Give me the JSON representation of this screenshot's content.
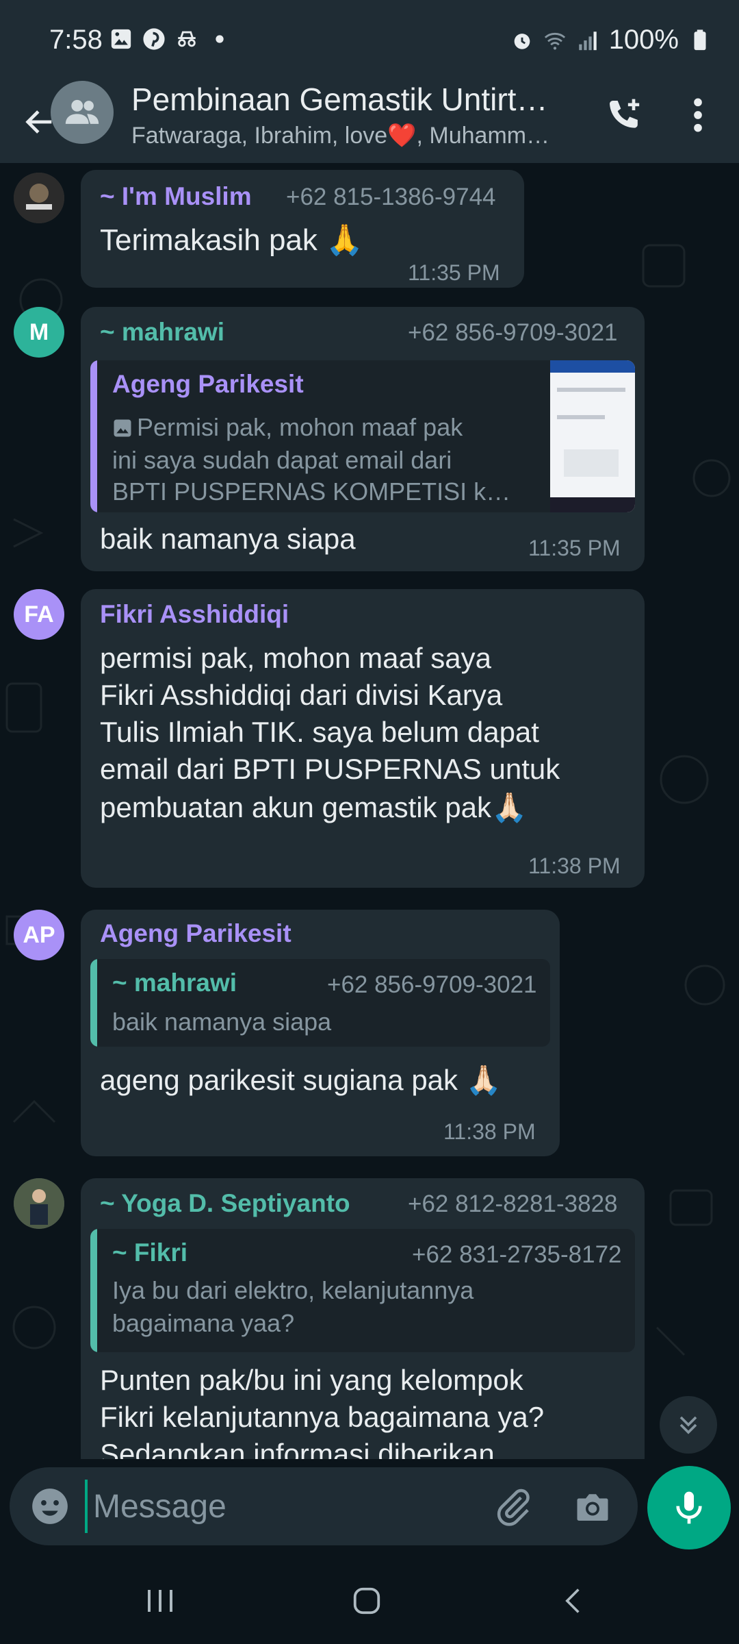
{
  "status_bar": {
    "time": "7:58",
    "battery": "100%",
    "left_icons": [
      "gallery-icon",
      "pinterest-icon",
      "incognito-icon",
      "dot-icon"
    ],
    "right_icons": [
      "alarm-icon",
      "wifi-icon",
      "signal-icon",
      "battery-icon"
    ]
  },
  "header": {
    "title": "Pembinaan Gemastik Untirt…",
    "subtitle": "Fatwaraga, Ibrahim, love❤️, Muhamm…"
  },
  "messages": [
    {
      "sender": "~ I'm Muslim",
      "phone": "+62 815-1386-9744",
      "text": "Terimakasih pak 🙏",
      "time": "11:35 PM"
    },
    {
      "avatar": "M",
      "sender": "~ mahrawi",
      "phone": "+62 856-9709-3021",
      "quote": {
        "name": "Ageng Parikesit",
        "text_line1": "Permisi pak, mohon maaf pak",
        "text_line2": "ini saya sudah dapat email dari",
        "text_line3": "BPTI PUSPERNAS KOMPETISI k…"
      },
      "text": "baik namanya siapa",
      "time": "11:35 PM"
    },
    {
      "avatar": "FA",
      "sender": "Fikri Asshiddiqi",
      "text_line1": "permisi pak, mohon maaf saya",
      "text_line2": "Fikri Asshiddiqi dari divisi Karya",
      "text_line3": "Tulis Ilmiah TIK. saya belum dapat",
      "text_line4": "email dari BPTI PUSPERNAS untuk",
      "text_line5": "pembuatan akun gemastik pak🙏🏻",
      "time": "11:38 PM"
    },
    {
      "avatar": "AP",
      "sender": "Ageng Parikesit",
      "quote": {
        "name": "~ mahrawi",
        "phone": "+62 856-9709-3021",
        "text": "baik namanya siapa"
      },
      "text": "ageng parikesit sugiana pak 🙏🏻",
      "time": "11:38 PM"
    },
    {
      "sender": "~ Yoga D. Septiyanto",
      "phone": "+62 812-8281-3828",
      "quote": {
        "name": "~ Fikri",
        "phone": "+62 831-2735-8172",
        "text_line1": "Iya bu dari elektro, kelanjutannya",
        "text_line2": "bagaimana yaa?"
      },
      "text_line1": "Punten pak/bu ini yang kelompok",
      "text_line2": "Fikri kelanjutannya bagaimana ya?",
      "text_line3": "Sedangkan informasi diberikan"
    }
  ],
  "composer": {
    "placeholder": "Message"
  },
  "colors": {
    "accent_green": "#00a884",
    "sender_purple": "#a991f7",
    "sender_teal": "#53bdaa",
    "bubble": "#202c33",
    "background": "#0b141a"
  }
}
